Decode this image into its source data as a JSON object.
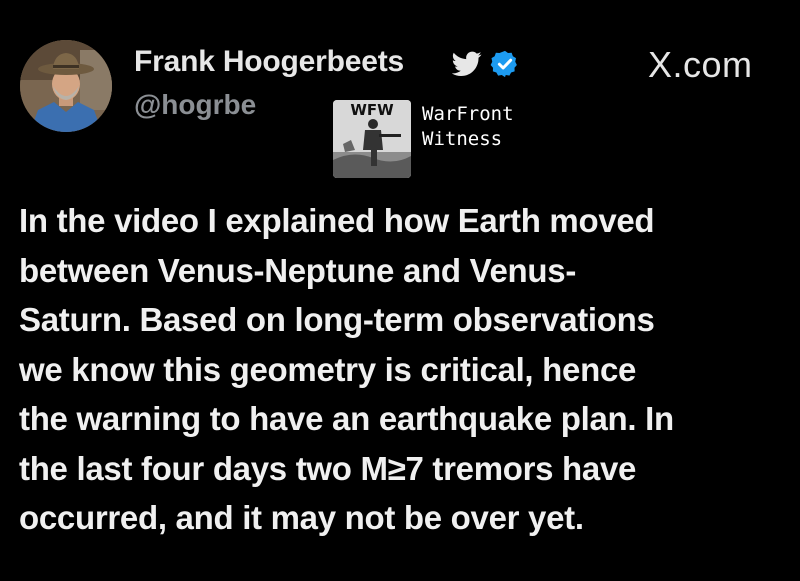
{
  "author": {
    "display_name": "Frank Hoogerbeets",
    "handle": "@hogrbe",
    "avatar_icon": "user-avatar-photo",
    "bird_icon": "twitter-bird-icon",
    "verified_icon": "verified-badge-icon",
    "verified_color": "#1d9bf0"
  },
  "brand": {
    "text": "X.com"
  },
  "watermark": {
    "logo_text": "WFW",
    "line1": "WarFront",
    "line2": "Witness"
  },
  "tweet": {
    "lines": [
      "In the video I explained how Earth moved",
      "between Venus-Neptune and Venus-",
      "Saturn. Based on long-term observations",
      "we know this geometry is critical, hence",
      "the warning to have an earthquake plan. In",
      "the last four days two M≥7 tremors have",
      "occurred, and it may not be over yet."
    ]
  },
  "colors": {
    "background": "#000000",
    "text_primary": "#f0f0f0",
    "text_secondary": "#8b8f94"
  }
}
